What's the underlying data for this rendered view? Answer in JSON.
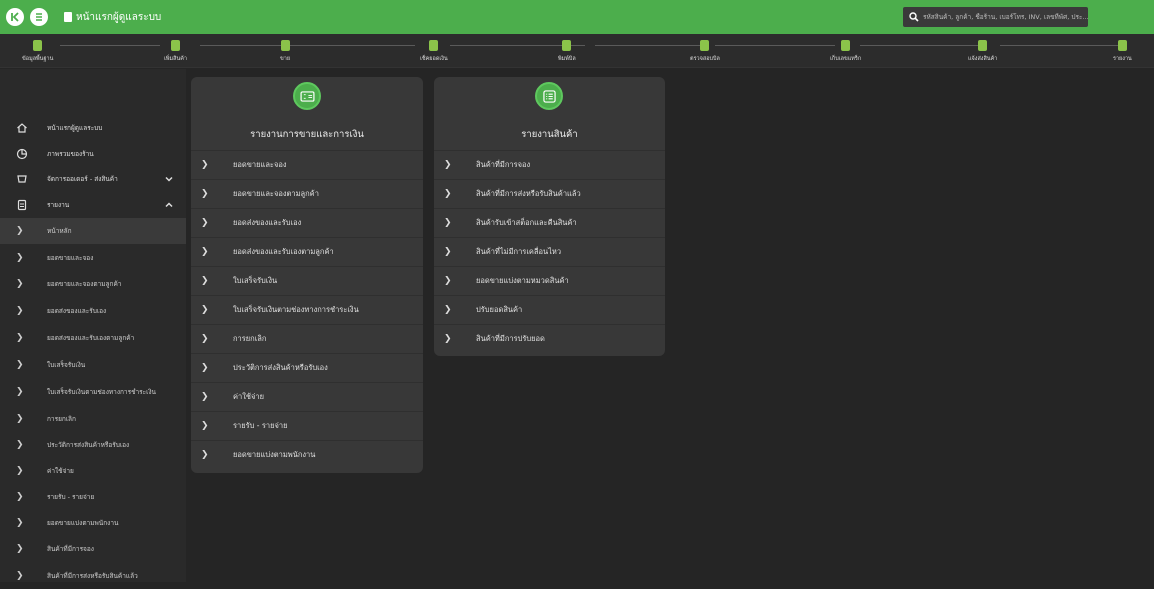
{
  "topbar": {
    "title": "หน้าแรกผู้ดูแลระบบ",
    "search_placeholder": "รหัสสินค้า, ลูกค้า, ชื่อร้าน, เบอร์โทร, INV, เลขที่พัศ, ประ...",
    "brand_color": "#4cae4c"
  },
  "nav": {
    "items": [
      {
        "label": "ข้อมูลพื้นฐาน",
        "icon": "database-icon"
      },
      {
        "label": "เพิ่มสินค้า",
        "icon": "add-product-icon"
      },
      {
        "label": "ขาย",
        "icon": "cart-icon"
      },
      {
        "label": "เช็คยอดเงิน",
        "icon": "money-check-icon"
      },
      {
        "label": "พิมพ์บิล",
        "icon": "printer-icon"
      },
      {
        "label": "ตรวจสอบบิล",
        "icon": "bill-check-icon"
      },
      {
        "label": "เก็บเลขแทร็ก",
        "icon": "barcode-icon"
      },
      {
        "label": "แจ้งส่งสินค้า",
        "icon": "truck-icon"
      },
      {
        "label": "รายงาน",
        "icon": "report-icon"
      }
    ]
  },
  "sidebar": {
    "main": [
      {
        "label": "หน้าแรกผู้ดูแลระบบ",
        "icon": "home-icon"
      },
      {
        "label": "ภาพรวมของร้าน",
        "icon": "pie-chart-icon"
      },
      {
        "label": "จัดการออเดอร์ - ส่งสินค้า",
        "icon": "order-icon"
      },
      {
        "label": "รายงาน",
        "icon": "report-icon"
      }
    ],
    "sub": [
      "หน้าหลัก",
      "ยอดขายและจอง",
      "ยอดขายและจองตามลูกค้า",
      "ยอดส่งของและรับเอง",
      "ยอดส่งของและรับเองตามลูกค้า",
      "ใบเสร็จรับเงิน",
      "ใบเสร็จรับเงินตามช่องทางการชำระเงิน",
      "การยกเลิก",
      "ประวัติการส่งสินค้าหรือรับเอง",
      "ค่าใช้จ่าย",
      "รายรับ - รายจ่าย",
      "ยอดขายแบ่งตามพนักงาน",
      "สินค้าที่มีการจอง",
      "สินค้าที่มีการส่งหรือรับสินค้าแล้ว"
    ]
  },
  "cards": {
    "sales": {
      "title": "รายงานการขายและการเงิน",
      "items": [
        "ยอดขายและจอง",
        "ยอดขายและจองตามลูกค้า",
        "ยอดส่งของและรับเอง",
        "ยอดส่งของและรับเองตามลูกค้า",
        "ใบเสร็จรับเงิน",
        "ใบเสร็จรับเงินตามช่องทางการชำระเงิน",
        "การยกเลิก",
        "ประวัติการส่งสินค้าหรือรับเอง",
        "ค่าใช้จ่าย",
        "รายรับ - รายจ่าย",
        "ยอดขายแบ่งตามพนักงาน"
      ]
    },
    "products": {
      "title": "รายงานสินค้า",
      "items": [
        "สินค้าที่มีการจอง",
        "สินค้าที่มีการส่งหรือรับสินค้าแล้ว",
        "สินค้ารับเข้าสต็อกและคืนสินค้า",
        "สินค้าที่ไม่มีการเคลื่อนไหว",
        "ยอดขายแบ่งตามหมวดสินค้า",
        "ปรับยอดสินค้า",
        "สินค้าที่มีการปรับยอด"
      ]
    }
  }
}
